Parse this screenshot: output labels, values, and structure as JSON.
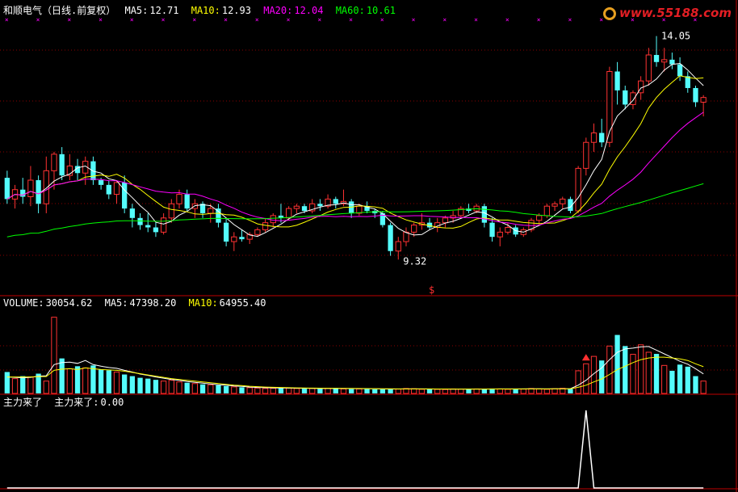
{
  "header": {
    "name": "和顺电气（日线.前复权）",
    "ma5_label": "MA5:",
    "ma5": "12.71",
    "ma10_label": "MA10:",
    "ma10": "12.93",
    "ma20_label": "MA20:",
    "ma20": "12.04",
    "ma60_label": "MA60:",
    "ma60": "10.61"
  },
  "volume_header": {
    "label": "VOLUME:",
    "value": "30054.62",
    "ma5_label": "MA5:",
    "ma5": "47398.20",
    "ma10_label": "MA10:",
    "ma10": "64955.40"
  },
  "indicator_header": {
    "name": "主力来了",
    "line_label": "主力来了:",
    "value": "0.00"
  },
  "logo": {
    "text": "www.55188.com"
  },
  "annotations": {
    "high": "14.05",
    "low": "9.32",
    "signal": "$"
  },
  "colors": {
    "up": "#ff3232",
    "down": "#54fcfc",
    "ma5": "#ffffff",
    "ma10": "#ffff00",
    "ma20": "#ff00ff",
    "ma60": "#00ff00",
    "frame": "#c00000",
    "label_ma": "#ffffff"
  },
  "chart_data": [
    {
      "type": "candlestick",
      "title": "和顺电气（日线.前复权）",
      "ylim": [
        9.0,
        14.3
      ],
      "candles": [
        {
          "o": 11.05,
          "h": 11.2,
          "l": 10.5,
          "c": 10.6
        },
        {
          "o": 10.6,
          "h": 10.9,
          "l": 10.4,
          "c": 10.8
        },
        {
          "o": 10.8,
          "h": 11.05,
          "l": 10.5,
          "c": 10.65
        },
        {
          "o": 10.65,
          "h": 11.3,
          "l": 10.45,
          "c": 11.0
        },
        {
          "o": 11.0,
          "h": 11.1,
          "l": 10.3,
          "c": 10.5
        },
        {
          "o": 10.5,
          "h": 11.5,
          "l": 10.3,
          "c": 11.2
        },
        {
          "o": 11.2,
          "h": 11.6,
          "l": 10.8,
          "c": 11.55
        },
        {
          "o": 11.55,
          "h": 11.7,
          "l": 11.0,
          "c": 11.1
        },
        {
          "o": 11.1,
          "h": 11.55,
          "l": 11.0,
          "c": 11.3
        },
        {
          "o": 11.3,
          "h": 11.45,
          "l": 11.0,
          "c": 11.15
        },
        {
          "o": 11.15,
          "h": 11.5,
          "l": 10.9,
          "c": 11.4
        },
        {
          "o": 11.4,
          "h": 11.5,
          "l": 10.9,
          "c": 11.0
        },
        {
          "o": 11.0,
          "h": 11.05,
          "l": 10.8,
          "c": 10.9
        },
        {
          "o": 10.9,
          "h": 11.0,
          "l": 10.6,
          "c": 10.7
        },
        {
          "o": 10.7,
          "h": 11.0,
          "l": 10.5,
          "c": 10.95
        },
        {
          "o": 10.95,
          "h": 11.1,
          "l": 10.3,
          "c": 10.4
        },
        {
          "o": 10.4,
          "h": 10.5,
          "l": 10.0,
          "c": 10.2
        },
        {
          "o": 10.2,
          "h": 10.3,
          "l": 9.95,
          "c": 10.05
        },
        {
          "o": 10.05,
          "h": 10.3,
          "l": 9.9,
          "c": 10.0
        },
        {
          "o": 10.0,
          "h": 10.1,
          "l": 9.8,
          "c": 9.9
        },
        {
          "o": 9.9,
          "h": 10.3,
          "l": 9.85,
          "c": 10.2
        },
        {
          "o": 10.2,
          "h": 10.6,
          "l": 10.1,
          "c": 10.5
        },
        {
          "o": 10.5,
          "h": 10.8,
          "l": 10.4,
          "c": 10.7
        },
        {
          "o": 10.7,
          "h": 10.8,
          "l": 10.35,
          "c": 10.4
        },
        {
          "o": 10.4,
          "h": 10.6,
          "l": 10.2,
          "c": 10.5
        },
        {
          "o": 10.5,
          "h": 10.55,
          "l": 10.2,
          "c": 10.3
        },
        {
          "o": 10.3,
          "h": 10.5,
          "l": 10.1,
          "c": 10.4
        },
        {
          "o": 10.4,
          "h": 10.5,
          "l": 10.0,
          "c": 10.1
        },
        {
          "o": 10.1,
          "h": 10.2,
          "l": 9.6,
          "c": 9.7
        },
        {
          "o": 9.7,
          "h": 9.9,
          "l": 9.5,
          "c": 9.8
        },
        {
          "o": 9.8,
          "h": 9.95,
          "l": 9.7,
          "c": 9.75
        },
        {
          "o": 9.75,
          "h": 9.9,
          "l": 9.65,
          "c": 9.85
        },
        {
          "o": 9.85,
          "h": 10.0,
          "l": 9.8,
          "c": 9.95
        },
        {
          "o": 9.95,
          "h": 10.2,
          "l": 9.9,
          "c": 10.1
        },
        {
          "o": 10.1,
          "h": 10.3,
          "l": 10.0,
          "c": 10.25
        },
        {
          "o": 10.25,
          "h": 10.5,
          "l": 10.1,
          "c": 10.2
        },
        {
          "o": 10.2,
          "h": 10.45,
          "l": 10.15,
          "c": 10.4
        },
        {
          "o": 10.4,
          "h": 10.5,
          "l": 10.3,
          "c": 10.45
        },
        {
          "o": 10.45,
          "h": 10.5,
          "l": 10.3,
          "c": 10.35
        },
        {
          "o": 10.35,
          "h": 10.6,
          "l": 10.3,
          "c": 10.5
        },
        {
          "o": 10.5,
          "h": 10.6,
          "l": 10.35,
          "c": 10.45
        },
        {
          "o": 10.45,
          "h": 10.7,
          "l": 10.4,
          "c": 10.6
        },
        {
          "o": 10.6,
          "h": 10.65,
          "l": 10.4,
          "c": 10.5
        },
        {
          "o": 10.5,
          "h": 10.8,
          "l": 10.45,
          "c": 10.55
        },
        {
          "o": 10.55,
          "h": 10.6,
          "l": 10.2,
          "c": 10.3
        },
        {
          "o": 10.3,
          "h": 10.5,
          "l": 10.25,
          "c": 10.45
        },
        {
          "o": 10.45,
          "h": 10.55,
          "l": 10.3,
          "c": 10.35
        },
        {
          "o": 10.35,
          "h": 10.4,
          "l": 10.2,
          "c": 10.3
        },
        {
          "o": 10.3,
          "h": 10.35,
          "l": 10.0,
          "c": 10.05
        },
        {
          "o": 10.05,
          "h": 10.1,
          "l": 9.4,
          "c": 9.5
        },
        {
          "o": 9.5,
          "h": 9.8,
          "l": 9.32,
          "c": 9.7
        },
        {
          "o": 9.7,
          "h": 10.0,
          "l": 9.6,
          "c": 9.9
        },
        {
          "o": 9.9,
          "h": 10.1,
          "l": 9.8,
          "c": 10.05
        },
        {
          "o": 10.05,
          "h": 10.3,
          "l": 9.95,
          "c": 10.1
        },
        {
          "o": 10.1,
          "h": 10.2,
          "l": 9.95,
          "c": 10.0
        },
        {
          "o": 10.0,
          "h": 10.2,
          "l": 9.9,
          "c": 10.1
        },
        {
          "o": 10.1,
          "h": 10.25,
          "l": 10.0,
          "c": 10.2
        },
        {
          "o": 10.2,
          "h": 10.35,
          "l": 10.1,
          "c": 10.25
        },
        {
          "o": 10.25,
          "h": 10.45,
          "l": 10.2,
          "c": 10.4
        },
        {
          "o": 10.4,
          "h": 10.5,
          "l": 10.3,
          "c": 10.35
        },
        {
          "o": 10.35,
          "h": 10.5,
          "l": 10.3,
          "c": 10.45
        },
        {
          "o": 10.45,
          "h": 10.5,
          "l": 10.0,
          "c": 10.1
        },
        {
          "o": 10.1,
          "h": 10.2,
          "l": 9.7,
          "c": 9.8
        },
        {
          "o": 9.8,
          "h": 10.0,
          "l": 9.6,
          "c": 9.9
        },
        {
          "o": 9.9,
          "h": 10.1,
          "l": 9.85,
          "c": 10.0
        },
        {
          "o": 10.0,
          "h": 10.05,
          "l": 9.8,
          "c": 9.85
        },
        {
          "o": 9.85,
          "h": 10.0,
          "l": 9.8,
          "c": 9.95
        },
        {
          "o": 9.95,
          "h": 10.2,
          "l": 9.9,
          "c": 10.15
        },
        {
          "o": 10.15,
          "h": 10.3,
          "l": 10.05,
          "c": 10.25
        },
        {
          "o": 10.25,
          "h": 10.5,
          "l": 10.2,
          "c": 10.45
        },
        {
          "o": 10.45,
          "h": 10.55,
          "l": 10.35,
          "c": 10.5
        },
        {
          "o": 10.5,
          "h": 10.65,
          "l": 10.4,
          "c": 10.6
        },
        {
          "o": 10.6,
          "h": 10.65,
          "l": 10.3,
          "c": 10.35
        },
        {
          "o": 10.35,
          "h": 11.3,
          "l": 10.3,
          "c": 11.25
        },
        {
          "o": 11.25,
          "h": 11.9,
          "l": 11.1,
          "c": 11.8
        },
        {
          "o": 11.8,
          "h": 12.2,
          "l": 11.6,
          "c": 12.0
        },
        {
          "o": 12.0,
          "h": 12.3,
          "l": 11.7,
          "c": 11.8
        },
        {
          "o": 11.8,
          "h": 13.4,
          "l": 11.7,
          "c": 13.3
        },
        {
          "o": 13.3,
          "h": 13.5,
          "l": 12.6,
          "c": 12.9
        },
        {
          "o": 12.9,
          "h": 13.0,
          "l": 12.5,
          "c": 12.6
        },
        {
          "o": 12.6,
          "h": 12.9,
          "l": 12.5,
          "c": 12.85
        },
        {
          "o": 12.85,
          "h": 13.2,
          "l": 12.7,
          "c": 13.1
        },
        {
          "o": 13.1,
          "h": 13.8,
          "l": 13.0,
          "c": 13.65
        },
        {
          "o": 13.65,
          "h": 14.05,
          "l": 13.4,
          "c": 13.5
        },
        {
          "o": 13.5,
          "h": 13.8,
          "l": 13.3,
          "c": 13.55
        },
        {
          "o": 13.55,
          "h": 13.7,
          "l": 13.35,
          "c": 13.45
        },
        {
          "o": 13.45,
          "h": 13.6,
          "l": 13.1,
          "c": 13.2
        },
        {
          "o": 13.2,
          "h": 13.3,
          "l": 12.85,
          "c": 12.95
        },
        {
          "o": 12.95,
          "h": 13.0,
          "l": 12.55,
          "c": 12.65
        },
        {
          "o": 12.65,
          "h": 12.8,
          "l": 12.35,
          "c": 12.75
        }
      ],
      "moving_averages": [
        {
          "name": "MA5",
          "color": "#ffffff"
        },
        {
          "name": "MA10",
          "color": "#ffff00"
        },
        {
          "name": "MA20",
          "color": "#ff00ff"
        },
        {
          "name": "MA60",
          "color": "#00ff00"
        }
      ]
    },
    {
      "type": "bar",
      "title": "VOLUME",
      "ylim": [
        0,
        200000
      ],
      "values": [
        52000,
        36000,
        42000,
        40000,
        48000,
        30000,
        185000,
        85000,
        60000,
        66000,
        62000,
        68000,
        58000,
        56000,
        52000,
        46000,
        42000,
        38000,
        36000,
        33000,
        30000,
        32000,
        28000,
        26000,
        24000,
        22000,
        21000,
        20000,
        18000,
        16000,
        15000,
        14000,
        13000,
        12000,
        12500,
        14000,
        13000,
        12000,
        11500,
        12000,
        11000,
        12500,
        13000,
        11000,
        10500,
        11000,
        12000,
        10000,
        9800,
        11000,
        10500,
        12000,
        11500,
        10000,
        11000,
        10000,
        9500,
        11000,
        10500,
        10000,
        11000,
        10500,
        12000,
        11000,
        10000,
        11500,
        10500,
        12000,
        11000,
        10000,
        11500,
        12500,
        11000,
        55000,
        72000,
        90000,
        80000,
        115000,
        142000,
        115000,
        95000,
        118000,
        100000,
        96000,
        68000,
        55000,
        70000,
        65000,
        42000,
        30054
      ],
      "ma5": [
        40000,
        39000,
        38000,
        39000,
        42000,
        43000,
        70000,
        75000,
        76000,
        73000,
        80000,
        70000,
        66000,
        63000,
        61000,
        56000,
        52000,
        47000,
        44000,
        40000,
        37000,
        34000,
        32000,
        29000,
        27000,
        25000,
        23000,
        21000,
        20000,
        18000,
        17000,
        15500,
        14500,
        14000,
        13500,
        13200,
        13000,
        12700,
        12500,
        12300,
        12000,
        12000,
        12000,
        12000,
        11800,
        11600,
        11500,
        11200,
        11000,
        10800,
        10700,
        10900,
        11000,
        11000,
        10800,
        10600,
        10500,
        10400,
        10500,
        10500,
        10500,
        10600,
        10800,
        11000,
        11000,
        11000,
        11000,
        11200,
        11200,
        11000,
        11200,
        11300,
        11500,
        20000,
        32000,
        48000,
        62000,
        82000,
        100000,
        108000,
        110000,
        113000,
        114000,
        105000,
        96000,
        87000,
        78000,
        71000,
        60000,
        47398
      ],
      "ma10": [
        40000,
        40000,
        40000,
        40000,
        41000,
        41000,
        56000,
        59000,
        60000,
        58000,
        62000,
        60000,
        58000,
        57000,
        56000,
        54000,
        51000,
        48000,
        45000,
        42000,
        39000,
        36000,
        34000,
        32000,
        30000,
        28000,
        26000,
        24000,
        22000,
        20000,
        19000,
        17500,
        16500,
        15500,
        15000,
        14500,
        14000,
        13500,
        13200,
        13000,
        12800,
        12600,
        12500,
        12300,
        12200,
        12000,
        11800,
        11600,
        11400,
        11200,
        11000,
        11000,
        11000,
        11000,
        10900,
        10800,
        10700,
        10600,
        10600,
        10600,
        10600,
        10600,
        10700,
        10800,
        10800,
        10800,
        10900,
        11000,
        11000,
        11000,
        11100,
        11200,
        11300,
        15000,
        20000,
        28000,
        35000,
        46000,
        58000,
        66000,
        75000,
        82000,
        86000,
        88000,
        88000,
        86000,
        84000,
        80000,
        72000,
        64955
      ]
    },
    {
      "type": "line",
      "title": "主力来了",
      "series": [
        {
          "name": "主力来了",
          "color": "#ffffff",
          "values": [
            0,
            0,
            0,
            0,
            0,
            0,
            0,
            0,
            0,
            0,
            0,
            0,
            0,
            0,
            0,
            0,
            0,
            0,
            0,
            0,
            0,
            0,
            0,
            0,
            0,
            0,
            0,
            0,
            0,
            0,
            0,
            0,
            0,
            0,
            0,
            0,
            0,
            0,
            0,
            0,
            0,
            0,
            0,
            0,
            0,
            0,
            0,
            0,
            0,
            0,
            0,
            0,
            0,
            0,
            0,
            0,
            0,
            0,
            0,
            0,
            0,
            0,
            0,
            0,
            0,
            0,
            0,
            0,
            0,
            0,
            0,
            0,
            0,
            0,
            1,
            0,
            0,
            0,
            0,
            0,
            0,
            0,
            0,
            0,
            0,
            0,
            0,
            0,
            0,
            0
          ]
        }
      ]
    }
  ]
}
